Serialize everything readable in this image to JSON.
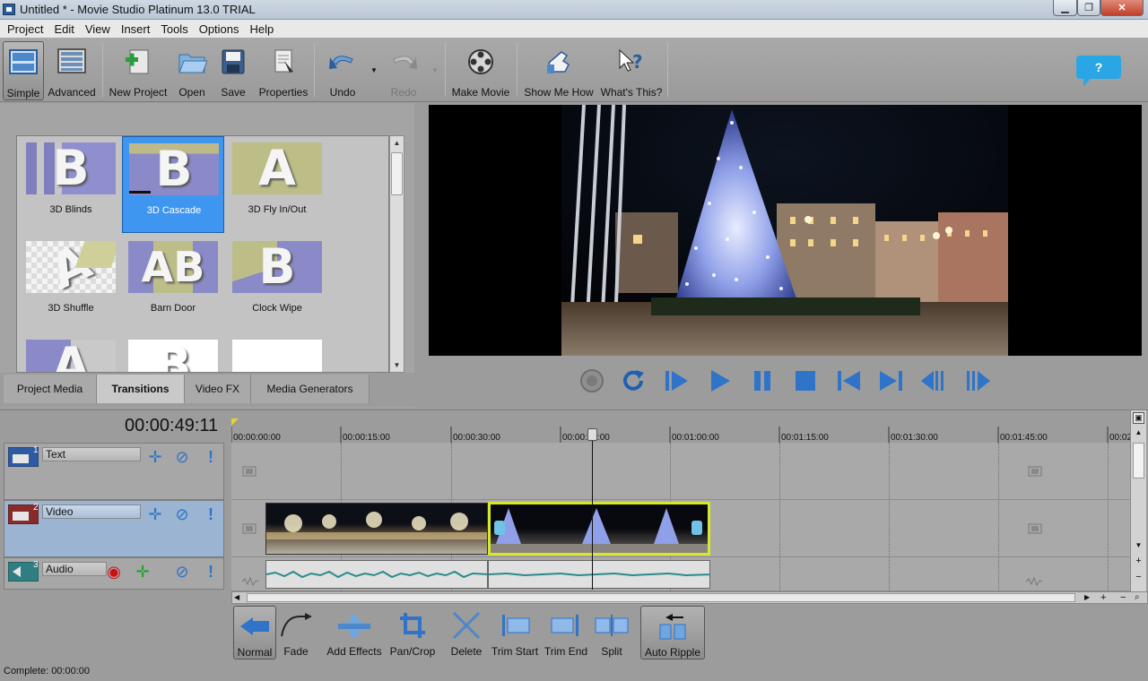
{
  "window": {
    "title": "Untitled * - Movie Studio Platinum 13.0 TRIAL",
    "min": "▁",
    "max": "❐",
    "close": "✕"
  },
  "menu": [
    "Project",
    "Edit",
    "View",
    "Insert",
    "Tools",
    "Options",
    "Help"
  ],
  "toolbar": {
    "simple": "Simple",
    "advanced": "Advanced",
    "new_project": "New Project",
    "open": "Open",
    "save": "Save",
    "properties": "Properties",
    "undo": "Undo",
    "redo": "Redo",
    "make_movie": "Make Movie",
    "show_me_how": "Show Me How",
    "whats_this": "What's This?"
  },
  "help_bubble": "?",
  "transitions": [
    {
      "label": "3D Blinds",
      "letter": "B"
    },
    {
      "label": "3D Cascade",
      "letter": "B",
      "selected": true
    },
    {
      "label": "3D Fly In/Out",
      "letter": "A"
    },
    {
      "label": "3D Shuffle",
      "letter": "A"
    },
    {
      "label": "Barn Door",
      "letter": "AB"
    },
    {
      "label": "Clock Wipe",
      "letter": "B"
    },
    {
      "label": "",
      "letter": "A"
    },
    {
      "label": "",
      "letter": "B"
    },
    {
      "label": "",
      "letter": ""
    }
  ],
  "panel_tabs": {
    "project_media": "Project Media",
    "transitions": "Transitions",
    "video_fx": "Video FX",
    "media_generators": "Media Generators"
  },
  "timecode": "00:00:49:11",
  "tracks": {
    "text": {
      "num": "1",
      "name": "Text"
    },
    "video": {
      "num": "2",
      "name": "Video"
    },
    "audio": {
      "num": "3",
      "name": "Audio"
    }
  },
  "ruler_ticks": [
    "00:00:00:00",
    "00:00:15:00",
    "00:00:30:00",
    "00:00:45:00",
    "00:01:00:00",
    "00:01:15:00",
    "00:01:30:00",
    "00:01:45:00",
    "00:02"
  ],
  "bottom_tools": {
    "normal": "Normal",
    "fade": "Fade",
    "add_effects": "Add Effects",
    "pan_crop": "Pan/Crop",
    "delete": "Delete",
    "trim_start": "Trim Start",
    "trim_end": "Trim End",
    "split": "Split",
    "auto_ripple": "Auto Ripple"
  },
  "status": "Complete: 00:00:00",
  "colors": {
    "accent_blue": "#3f96f0",
    "selected_clip_border": "#d7e82a",
    "help_blue": "#2aa6e6"
  }
}
